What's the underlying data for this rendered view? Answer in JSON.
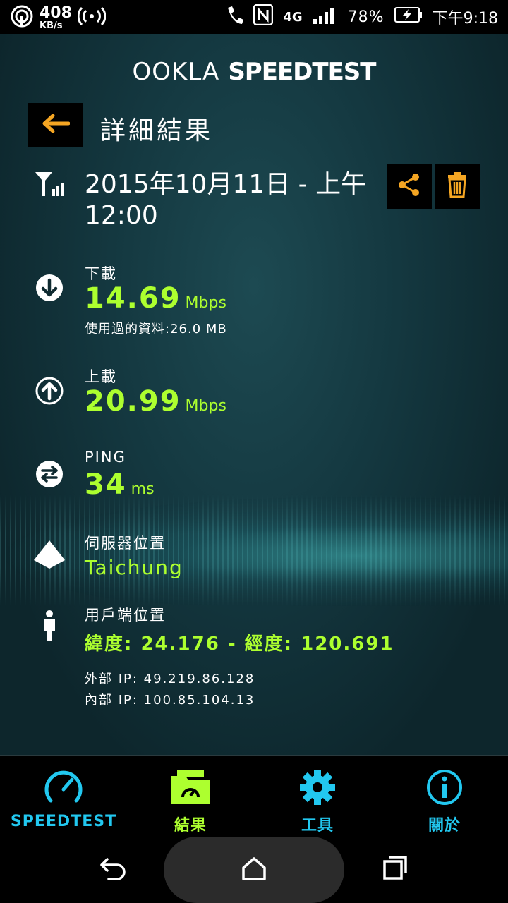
{
  "status_bar": {
    "net_speed": "408",
    "net_speed_unit": "KB/s",
    "network_type": "4G",
    "battery": "78%",
    "time": "下午9:18"
  },
  "header": {
    "logo_brand": "OOKLA",
    "logo_product": "SPEEDTEST",
    "title": "詳細結果"
  },
  "result": {
    "datetime": "2015年10月11日 - 上午12:00",
    "download": {
      "label": "下載",
      "value": "14.69",
      "unit": "Mbps",
      "data_used": "使用過的資料:26.0 MB"
    },
    "upload": {
      "label": "上載",
      "value": "20.99",
      "unit": "Mbps"
    },
    "ping": {
      "label": "PING",
      "value": "34",
      "unit": "ms"
    },
    "server": {
      "label": "伺服器位置",
      "value": "Taichung"
    },
    "client": {
      "label": "用戶端位置",
      "coords": "緯度: 24.176 - 經度: 120.691",
      "external_ip": "外部 IP: 49.219.86.128",
      "internal_ip": "內部 IP: 100.85.104.13"
    }
  },
  "bottom_nav": {
    "items": [
      {
        "label": "SPEEDTEST",
        "color": "#22c8f0",
        "active": false
      },
      {
        "label": "結果",
        "color": "#adff2f",
        "active": true
      },
      {
        "label": "工具",
        "color": "#22c8f0",
        "active": false
      },
      {
        "label": "關於",
        "color": "#22c8f0",
        "active": false
      }
    ]
  },
  "colors": {
    "accent_green": "#adff2f",
    "accent_cyan": "#22c8f0",
    "accent_orange": "#f5a623"
  }
}
